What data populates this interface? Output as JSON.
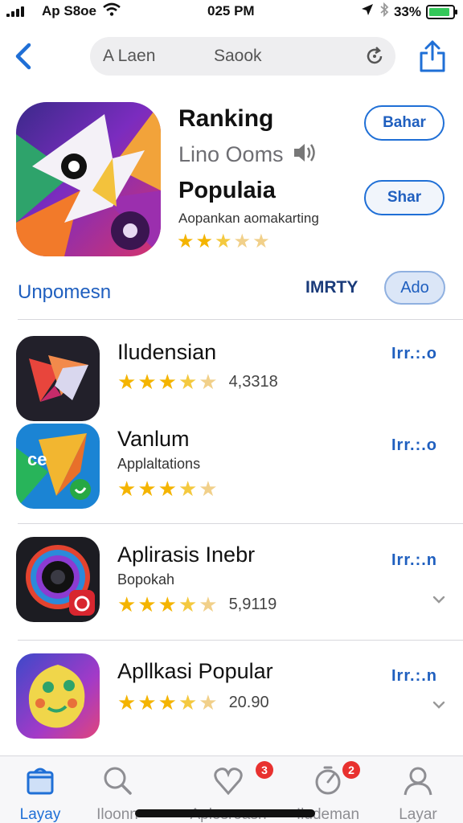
{
  "status_bar": {
    "carrier": "Ap S8oe",
    "time": "025 PM",
    "battery_text": "33%",
    "battery_level": 0.9,
    "colors": {
      "battery": "#34c759"
    }
  },
  "nav": {
    "search_left_text": "A Laen",
    "search_mid_text": "Saook",
    "icons": [
      "chevron-left-icon",
      "refresh-icon",
      "share-icon"
    ]
  },
  "hero": {
    "title": "Ranking",
    "subtitle": "Lino Ooms",
    "category": "Populaia",
    "description": "Aopankan aomakarting",
    "rating": 2.5,
    "button1": "Bahar",
    "button2": "Shar"
  },
  "section": {
    "title": "Unpomesn",
    "tag": "IMRTY",
    "add_label": "Ado"
  },
  "list": [
    {
      "name": "Iludensian",
      "subtitle": "",
      "rating": 3.5,
      "count": "4,3318",
      "action": "Irr.:.o",
      "chevron": false
    },
    {
      "name": "Vanlum",
      "subtitle": "Applaltations",
      "rating": 3.5,
      "count": "",
      "action": "Irr.:.o",
      "chevron": false
    },
    {
      "name": "Aplirasis Inebr",
      "subtitle": "Bopokah",
      "rating": 3.5,
      "count": "5,9119",
      "action": "Irr.:.n",
      "chevron": true
    },
    {
      "name": "Apllkasi Popular",
      "subtitle": "",
      "rating": 3.5,
      "count": "20.90",
      "action": "Irr.:.n",
      "chevron": true
    }
  ],
  "tabbar": {
    "tabs": [
      {
        "label": "Layay",
        "icon": "store-icon",
        "badge": ""
      },
      {
        "label": "Iloonn",
        "icon": "search-icon",
        "badge": ""
      },
      {
        "label": "Aplosroasn",
        "icon": "heart-icon",
        "badge": "3"
      },
      {
        "label": "Iludeman",
        "icon": "timer-icon",
        "badge": "2"
      },
      {
        "label": "Layar",
        "icon": "profile-icon",
        "badge": ""
      }
    ],
    "active_index": 0,
    "colors": {
      "active": "#1f6fd6",
      "inactive": "#8e8e93",
      "badge": "#e8312f"
    }
  }
}
